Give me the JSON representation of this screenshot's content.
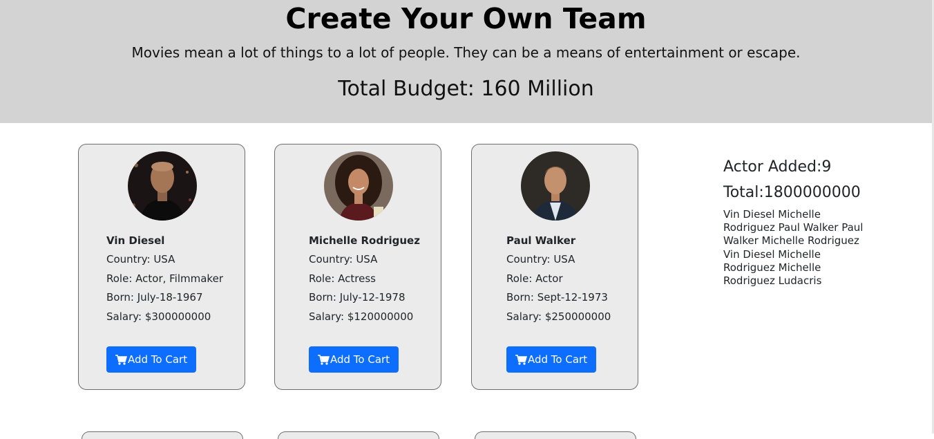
{
  "header": {
    "title": "Create Your Own Team",
    "subtitle": "Movies mean a lot of things to a lot of people. They can be a means of entertainment or escape.",
    "budget": "Total Budget: 160 Million"
  },
  "actors": [
    {
      "name": "Vin Diesel",
      "country": "Country: USA",
      "role": "Role: Actor, Filmmaker",
      "born": "Born: July-18-1967",
      "salary": "Salary: $300000000",
      "button": "Add To Cart",
      "icon": "cart-icon"
    },
    {
      "name": "Michelle Rodriguez",
      "country": "Country: USA",
      "role": "Role: Actress",
      "born": "Born: July-12-1978",
      "salary": "Salary: $120000000",
      "button": "Add To Cart",
      "icon": "cart-icon"
    },
    {
      "name": "Paul Walker",
      "country": "Country: USA",
      "role": "Role: Actor",
      "born": "Born: Sept-12-1973",
      "salary": "Salary: $250000000",
      "button": "Add To Cart",
      "icon": "cart-icon"
    }
  ],
  "cart": {
    "added": "Actor Added:9",
    "total": "Total:1800000000",
    "names": "Vin Diesel Michelle Rodriguez Paul Walker Paul Walker Michelle Rodriguez Vin Diesel Michelle Rodriguez Michelle Rodriguez Ludacris"
  },
  "colors": {
    "header_bg": "#d3d3d3",
    "card_bg": "#ebebeb",
    "button_bg": "#0d6efd"
  }
}
